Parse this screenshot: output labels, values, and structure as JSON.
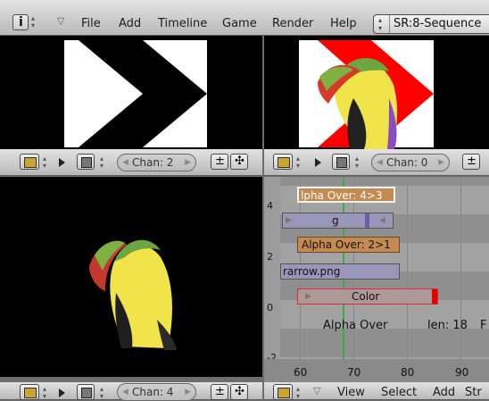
{
  "top_header": {
    "info_icon": "info-icon",
    "menu": [
      "File",
      "Add",
      "Timeline",
      "Game",
      "Render",
      "Help"
    ],
    "scene_selector": "SR:8-Sequence"
  },
  "preview_headers": [
    {
      "channel": "Chan: 2"
    },
    {
      "channel": "Chan: 0"
    },
    {
      "channel": "Chan: 4"
    }
  ],
  "sequencer": {
    "y_labels": [
      "4",
      "2",
      "0",
      "-2"
    ],
    "x_labels": [
      "60",
      "70",
      "80",
      "90"
    ],
    "strips": [
      {
        "label": "lpha Over: 4>3",
        "color": "#c58a50"
      },
      {
        "label": "g",
        "color": "#9a96b8"
      },
      {
        "label": "Alpha Over: 2>1",
        "color": "#c58a50"
      },
      {
        "label": "rarrow.png",
        "color": "#9a96b8"
      },
      {
        "label": "Color",
        "color": "#b09898"
      }
    ],
    "status": {
      "name": "Alpha Over",
      "length": "len: 18",
      "extra": "F"
    }
  },
  "bottom_header": {
    "menu": [
      "View",
      "Select",
      "Add",
      "Str"
    ]
  },
  "colors": {
    "background": "#000000",
    "arrow_red": "#ff0000",
    "playhead": "#3da84d",
    "grid": "#868686"
  }
}
